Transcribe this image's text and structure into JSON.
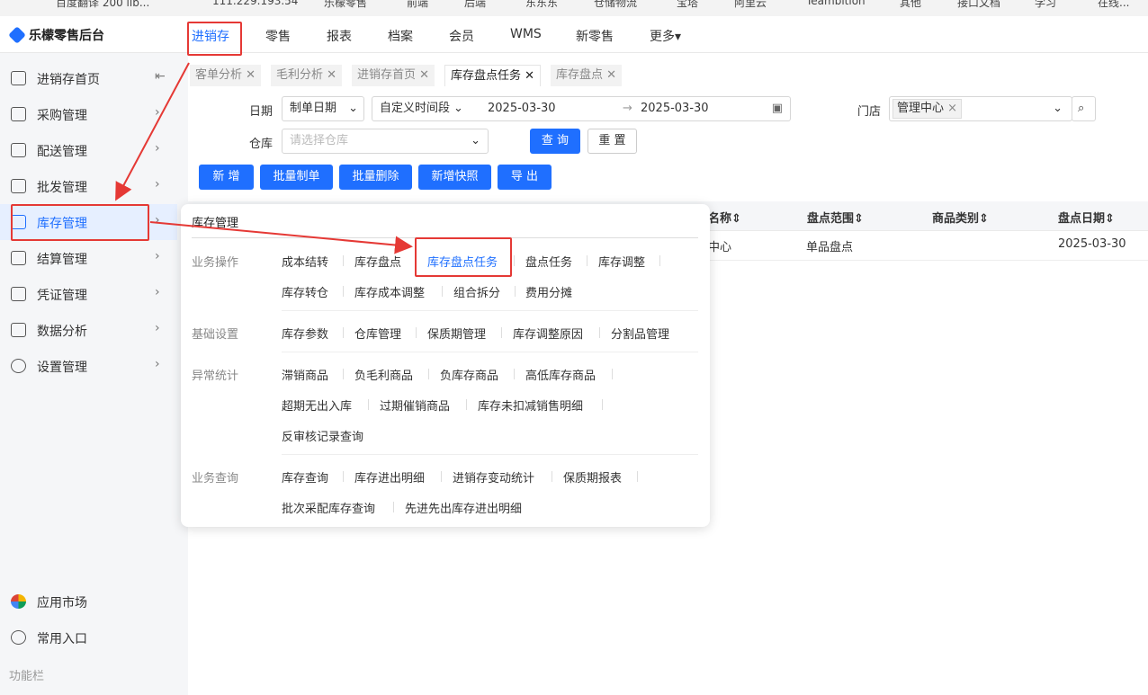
{
  "bookmarks": [
    "百度翻译 200 lib...",
    "111.229.193.54",
    "乐檬零售",
    "前端",
    "后端",
    "东东东",
    "仓储物流",
    "宝塔",
    "阿里云",
    "Teambition",
    "其他",
    "接口文档",
    "学习",
    "在线..."
  ],
  "app": {
    "title": "乐檬零售后台"
  },
  "topnav": [
    "进销存",
    "零售",
    "报表",
    "档案",
    "会员",
    "WMS",
    "新零售",
    "更多"
  ],
  "sidebar": {
    "items": [
      {
        "label": "进销存首页",
        "icon": "home-icon"
      },
      {
        "label": "采购管理",
        "icon": "cart-icon"
      },
      {
        "label": "配送管理",
        "icon": "map-icon"
      },
      {
        "label": "批发管理",
        "icon": "box-icon"
      },
      {
        "label": "库存管理",
        "icon": "inventory-icon"
      },
      {
        "label": "结算管理",
        "icon": "dollar-icon"
      },
      {
        "label": "凭证管理",
        "icon": "document-icon"
      },
      {
        "label": "数据分析",
        "icon": "chart-icon"
      },
      {
        "label": "设置管理",
        "icon": "settings-icon"
      }
    ],
    "app_market": "应用市场",
    "common_entry": "常用入口",
    "function_bar": "功能栏"
  },
  "tabs": [
    "客单分析",
    "毛利分析",
    "进销存首页",
    "库存盘点任务",
    "库存盘点"
  ],
  "filters": {
    "date_label": "日期",
    "date_type": "制单日期",
    "range_type": "自定义时间段",
    "start": "2025-03-30",
    "end": "2025-03-30",
    "store_label": "门店",
    "store_tag": "管理中心",
    "warehouse_label": "仓库",
    "warehouse_placeholder": "请选择仓库",
    "query": "查 询",
    "reset": "重 置"
  },
  "actions": [
    "新 增",
    "批量制单",
    "批量删除",
    "新增快照",
    "导 出"
  ],
  "table": {
    "headers": [
      "名称",
      "盘点范围",
      "商品类别",
      "盘点日期"
    ],
    "row": {
      "name": "中心",
      "range": "单品盘点",
      "date": "2025-03-30"
    }
  },
  "popup": {
    "title": "库存管理",
    "groups": [
      {
        "name": "业务操作",
        "rows": [
          [
            "成本结转",
            "库存盘点",
            "库存盘点任务",
            "盘点任务",
            "库存调整"
          ],
          [
            "库存转仓",
            "库存成本调整",
            "组合拆分",
            "费用分摊"
          ]
        ]
      },
      {
        "name": "基础设置",
        "rows": [
          [
            "库存参数",
            "仓库管理",
            "保质期管理",
            "库存调整原因",
            "分割品管理"
          ]
        ]
      },
      {
        "name": "异常统计",
        "rows": [
          [
            "滞销商品",
            "负毛利商品",
            "负库存商品",
            "高低库存商品"
          ],
          [
            "超期无出入库",
            "过期催销商品",
            "库存未扣减销售明细"
          ],
          [
            "反审核记录查询"
          ]
        ]
      },
      {
        "name": "业务查询",
        "rows": [
          [
            "库存查询",
            "库存进出明细",
            "进销存变动统计",
            "保质期报表"
          ],
          [
            "批次采配库存查询",
            "先进先出库存进出明细"
          ]
        ]
      }
    ]
  },
  "colors": {
    "primary": "#1f6fff",
    "highlight": "#e53935"
  }
}
